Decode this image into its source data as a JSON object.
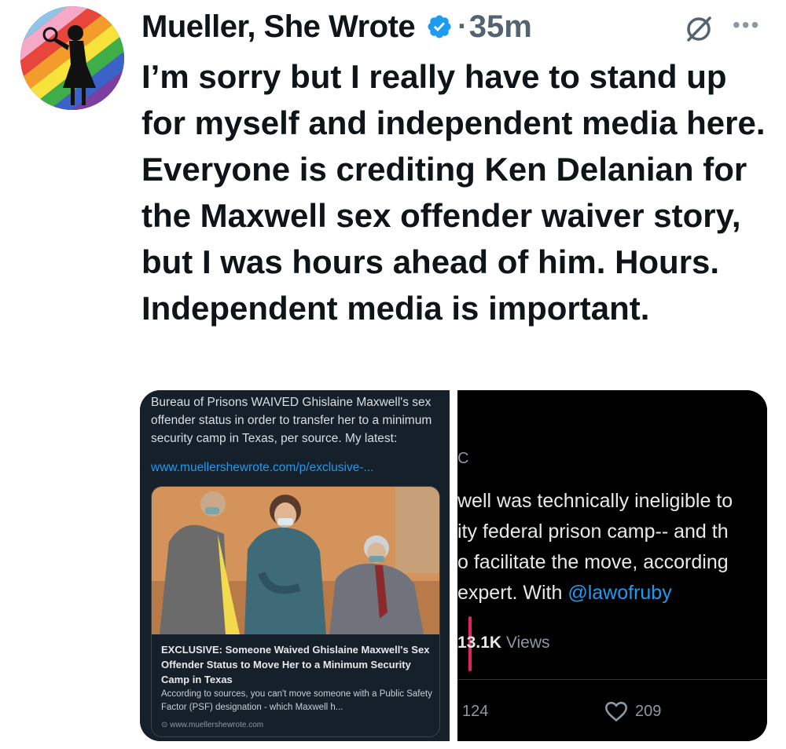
{
  "tweet": {
    "author_name": "Mueller, She Wrote",
    "separator": "·",
    "time": "35m",
    "more_label": "•••",
    "text": "I’m sorry but I really have to stand up for myself and independent media here. Everyone is crediting Ken Delanian for the Maxwell sex offender waiver story, but I was hours ahead of him. Hours. Independent media is important."
  },
  "left_screenshot": {
    "post_text": "Bureau of Prisons WAIVED Ghislaine Maxwell's sex offender status in order to transfer her to a minimum security camp in Texas, per source. My latest:",
    "link": "www.muellershewrote.com/p/exclusive-...",
    "card": {
      "title": "EXCLUSIVE: Someone Waived Ghislaine Maxwell's Sex Offender Status to Move Her to a Minimum Security Camp in Texas",
      "description": "According to sources, you can't move someone with a Public Safety Factor (PSF) designation - which Maxwell h...",
      "domain": "⊙ www.muellershewrote.com"
    }
  },
  "right_screenshot": {
    "fragment_c": "C",
    "line1": "well was technically ineligible to",
    "line2": "ity federal prison camp-- and th",
    "line3": "o facilitate the move, according",
    "line4_prefix": "expert. With ",
    "handle": "@lawofruby",
    "views_count": "13.1K",
    "views_label": " Views",
    "replies": "124",
    "likes": "209"
  },
  "colors": {
    "verified_blue": "#1d9bf0",
    "text_primary": "#0f1419",
    "text_secondary": "#536471",
    "dark_bg": "#15202b"
  },
  "icons": [
    "verified-badge-icon",
    "grok-icon",
    "more-options-icon",
    "heart-icon"
  ]
}
